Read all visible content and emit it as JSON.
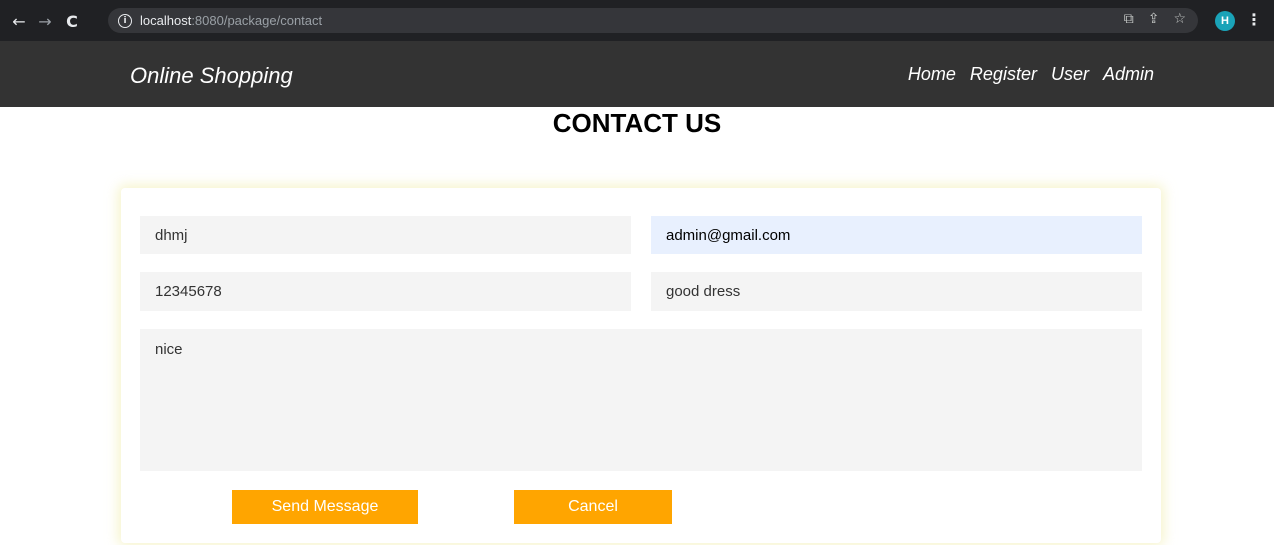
{
  "browser": {
    "url_host": "localhost",
    "url_path": ":8080/package/contact",
    "profile_initial": "H",
    "icons": [
      "back-arrow-icon",
      "forward-arrow-icon",
      "reload-icon",
      "info-icon",
      "translate-icon",
      "share-icon",
      "bookmark-star-icon",
      "kebab-menu-icon"
    ]
  },
  "header": {
    "brand": "Online Shopping",
    "nav": [
      "Home",
      "Register",
      "User",
      "Admin"
    ]
  },
  "page": {
    "title": "CONTACT US"
  },
  "form": {
    "name_value": "dhmj",
    "email_value": "admin@gmail.com",
    "phone_value": "12345678",
    "subject_value": "good dress",
    "message_value": "nice",
    "send_label": "Send Message",
    "cancel_label": "Cancel"
  },
  "colors": {
    "header_bg": "#333333",
    "button_bg": "#ffa500",
    "field_bg": "#f4f4f4",
    "autofill_bg": "#e8f0fe"
  }
}
